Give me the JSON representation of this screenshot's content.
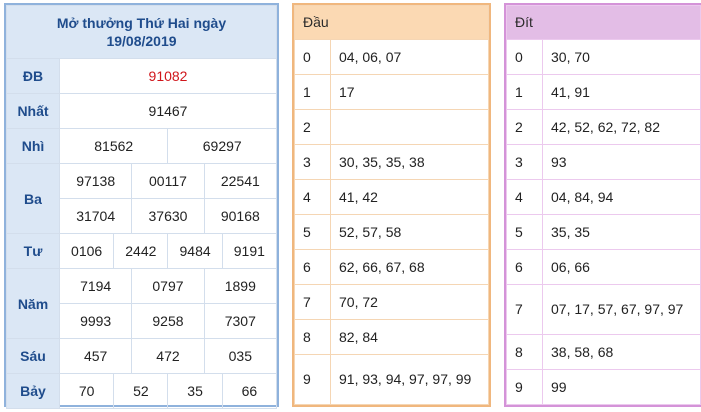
{
  "results": {
    "title_line1": "Mở thưởng Thứ Hai ngày",
    "title_line2": "19/08/2019",
    "rows": [
      {
        "label": "ĐB",
        "numbers": [
          "91082"
        ]
      },
      {
        "label": "Nhất",
        "numbers": [
          "91467"
        ]
      },
      {
        "label": "Nhì",
        "numbers": [
          "81562",
          "69297"
        ]
      },
      {
        "label": "Ba",
        "numbers": [
          "97138",
          "00117",
          "22541",
          "31704",
          "37630",
          "90168"
        ]
      },
      {
        "label": "Tư",
        "numbers": [
          "0106",
          "2442",
          "9484",
          "9191"
        ]
      },
      {
        "label": "Năm",
        "numbers": [
          "7194",
          "0797",
          "1899",
          "9993",
          "9258",
          "7307"
        ]
      },
      {
        "label": "Sáu",
        "numbers": [
          "457",
          "472",
          "035"
        ]
      },
      {
        "label": "Bảy",
        "numbers": [
          "70",
          "52",
          "35",
          "66"
        ]
      }
    ],
    "special_color": "#d0161b"
  },
  "dau": {
    "title": "Đầu",
    "rows": [
      {
        "digit": "0",
        "values": "04, 06, 07"
      },
      {
        "digit": "1",
        "values": "17"
      },
      {
        "digit": "2",
        "values": ""
      },
      {
        "digit": "3",
        "values": "30, 35, 35, 38"
      },
      {
        "digit": "4",
        "values": "41, 42"
      },
      {
        "digit": "5",
        "values": "52, 57, 58"
      },
      {
        "digit": "6",
        "values": "62, 66, 67, 68"
      },
      {
        "digit": "7",
        "values": "70, 72"
      },
      {
        "digit": "8",
        "values": "82, 84"
      },
      {
        "digit": "9",
        "values": "91, 93, 94, 97, 97, 99"
      }
    ]
  },
  "dit": {
    "title": "Đít",
    "rows": [
      {
        "digit": "0",
        "values": "30, 70"
      },
      {
        "digit": "1",
        "values": "41, 91"
      },
      {
        "digit": "2",
        "values": "42, 52, 62, 72, 82"
      },
      {
        "digit": "3",
        "values": "93"
      },
      {
        "digit": "4",
        "values": "04, 84, 94"
      },
      {
        "digit": "5",
        "values": "35, 35"
      },
      {
        "digit": "6",
        "values": "06, 66"
      },
      {
        "digit": "7",
        "values": "07, 17, 57, 67, 97, 97"
      },
      {
        "digit": "8",
        "values": "38, 58, 68"
      },
      {
        "digit": "9",
        "values": "99"
      }
    ]
  }
}
